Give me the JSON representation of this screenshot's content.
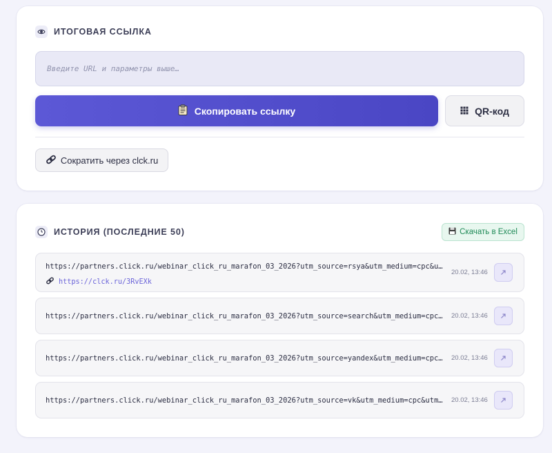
{
  "result": {
    "title": "Итоговая ссылка",
    "title_icon": "eye-icon",
    "url_placeholder": "Введите URL и параметры выше…",
    "copy_button": {
      "label": "Скопировать ссылку",
      "icon": "clipboard-icon"
    },
    "qr_button": {
      "label": "QR-код",
      "icon": "qr-grid-icon"
    },
    "shorten_button": {
      "label": "Сократить через clck.ru",
      "icon": "link-icon"
    }
  },
  "history": {
    "title": "История (последние 50)",
    "title_icon": "clock-icon",
    "export_button": {
      "label": "Скачать в Excel",
      "icon": "floppy-icon"
    },
    "items": [
      {
        "url": "https://partners.click.ru/webinar_click_ru_marafon_03_2026?utm_source=rsya&utm_medium=cpc&utm_campaign=marafon",
        "short_url": "https://clck.ru/3RvEXk",
        "date": "20.02, 13:46"
      },
      {
        "url": "https://partners.click.ru/webinar_click_ru_marafon_03_2026?utm_source=search&utm_medium=cpc&utm_campaign=marafon",
        "short_url": "",
        "date": "20.02, 13:46"
      },
      {
        "url": "https://partners.click.ru/webinar_click_ru_marafon_03_2026?utm_source=yandex&utm_medium=cpc&utm_campaign=marafon",
        "short_url": "",
        "date": "20.02, 13:46"
      },
      {
        "url": "https://partners.click.ru/webinar_click_ru_marafon_03_2026?utm_source=vk&utm_medium=cpc&utm_campaign=marafon",
        "short_url": "",
        "date": "20.02, 13:46"
      }
    ]
  },
  "colors": {
    "accent": "#5753d3",
    "excel_green": "#1f8a57",
    "short_link": "#6a63d9",
    "background": "#f3f3fb"
  }
}
